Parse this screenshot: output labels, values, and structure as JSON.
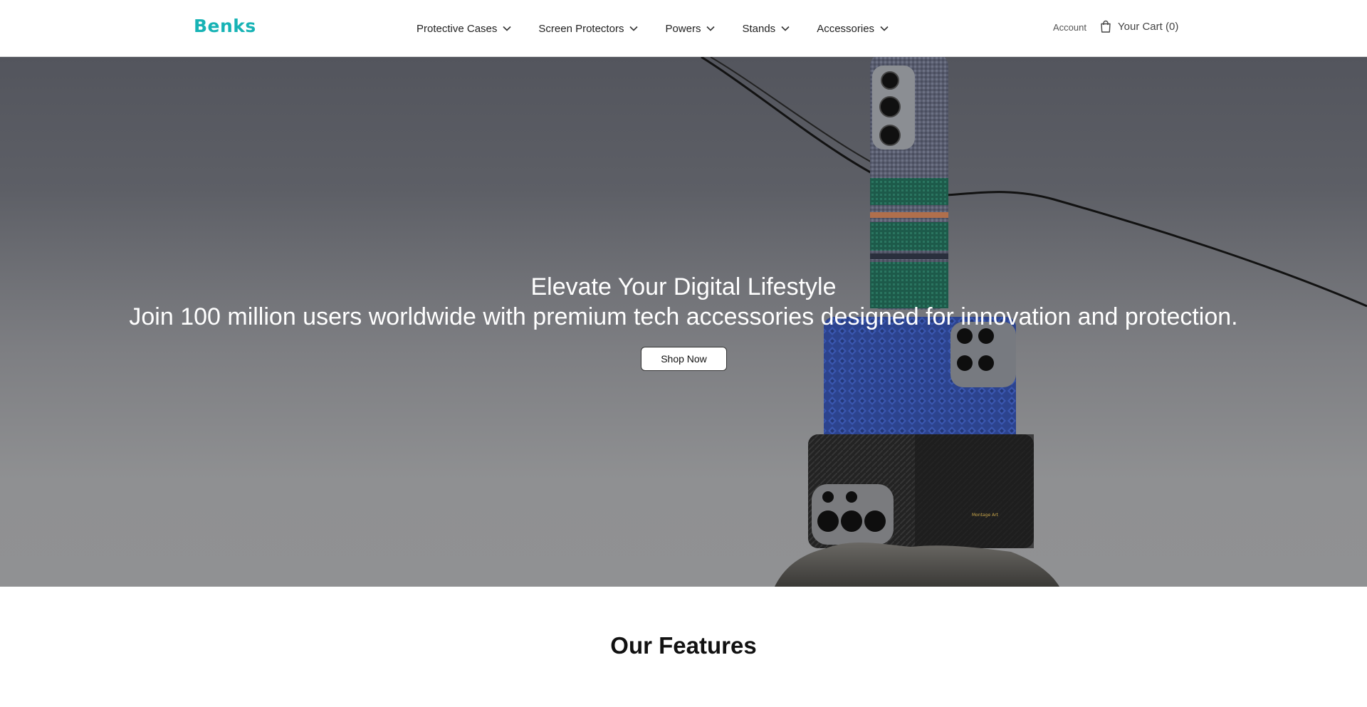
{
  "header": {
    "logo": "Benks",
    "nav": [
      {
        "label": "Protective Cases"
      },
      {
        "label": "Screen Protectors"
      },
      {
        "label": "Powers"
      },
      {
        "label": "Stands"
      },
      {
        "label": "Accessories"
      }
    ],
    "account_label": "Account",
    "cart_label": "Your Cart (0)"
  },
  "hero": {
    "title": "Elevate Your Digital Lifestyle",
    "subtitle": "Join 100 million users worldwide with premium tech accessories designed for innovation and protection.",
    "cta_label": "Shop Now",
    "phone_case_text": "Montage Art"
  },
  "features": {
    "title": "Our Features"
  },
  "colors": {
    "brand": "#17b3b5",
    "hero_top": "#53555d",
    "hero_bottom": "#909193"
  }
}
